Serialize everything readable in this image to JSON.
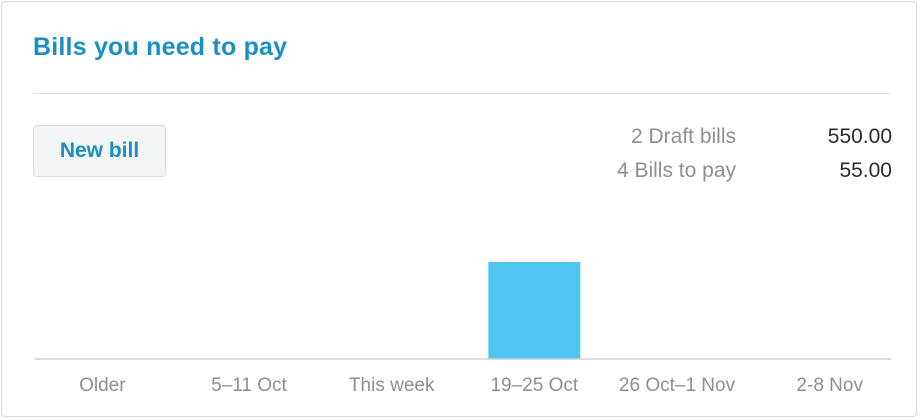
{
  "card": {
    "title": "Bills you need to pay"
  },
  "actions": {
    "new_bill_label": "New bill"
  },
  "summary": [
    {
      "label": "2 Draft bills",
      "value": "550.00"
    },
    {
      "label": "4 Bills to pay",
      "value": "55.00"
    }
  ],
  "colors": {
    "accent": "#1a8fc4",
    "bar": "#4fc6f2"
  },
  "chart_data": {
    "type": "bar",
    "categories": [
      "Older",
      "5–11 Oct",
      "This week",
      "19–25 Oct",
      "26 Oct–1 Nov",
      "2-8 Nov"
    ],
    "values": [
      0,
      0,
      0,
      55,
      0,
      0
    ],
    "title": "",
    "xlabel": "",
    "ylabel": "",
    "ylim": [
      0,
      55
    ],
    "grid": false,
    "legend": "none"
  }
}
